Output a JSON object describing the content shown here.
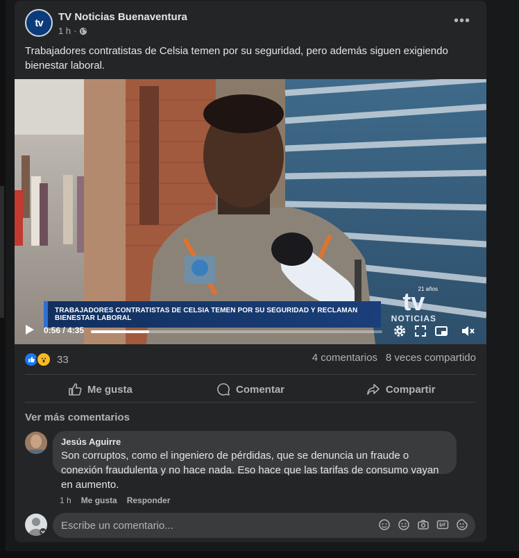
{
  "post": {
    "page_name": "TV Noticias Buenaventura",
    "time": "1 h",
    "audience_icon": "globe-icon",
    "text": "Trabajadores contratistas de Celsia temen por su seguridad, pero además siguen exigiendo bienestar laboral.",
    "avatar_logo": "tv"
  },
  "video": {
    "caption": "TRABAJADORES CONTRATISTAS DE CELSIA TEMEN POR SU SEGURIDAD Y RECLAMAN BIENESTAR LABORAL",
    "watermark_logo": "tv",
    "watermark_anos": "21 años",
    "watermark_text": "NOTICIAS",
    "time": "0:56 / 4:35",
    "progress": 0.2
  },
  "stats": {
    "reactions_count": "33",
    "comments": "4 comentarios",
    "shares": "8 veces compartido"
  },
  "actions": {
    "like": "Me gusta",
    "comment": "Comentar",
    "share": "Compartir"
  },
  "comments": {
    "see_more": "Ver más comentarios",
    "items": [
      {
        "author": "Jesús Aguirre",
        "text": "Son corruptos, como el ingeniero de pérdidas, que se denuncia un fraude o conexión fraudulenta y no hace nada. Eso hace que las tarifas de consumo vayan en aumento.",
        "time": "1 h",
        "like": "Me gusta",
        "reply": "Responder"
      }
    ]
  },
  "composer": {
    "placeholder": "Escribe un comentario..."
  },
  "colors": {
    "background": "#18191a",
    "card": "#242526",
    "accent": "#1877f2",
    "caption_bar": "#12305f"
  }
}
